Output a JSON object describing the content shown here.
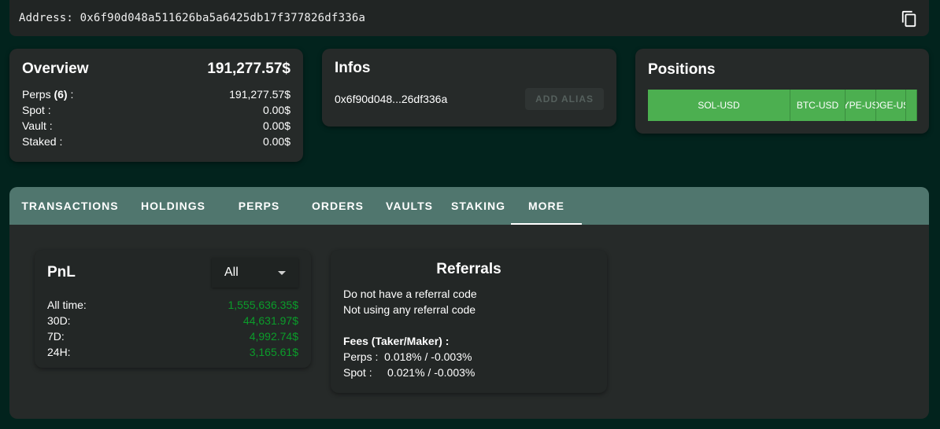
{
  "address": {
    "label": "Address:",
    "value": "0x6f90d048a511626ba5a6425db17f377826df336a",
    "copy_icon": "copy-icon"
  },
  "overview": {
    "title": "Overview",
    "total": "191,277.57$",
    "rows": [
      {
        "label": "Perps",
        "count": "(6)",
        "suffix": " :",
        "value": "191,277.57$"
      },
      {
        "label": "Spot :",
        "value": "0.00$"
      },
      {
        "label": "Vault :",
        "value": "0.00$"
      },
      {
        "label": "Staked :",
        "value": "0.00$"
      }
    ]
  },
  "infos": {
    "title": "Infos",
    "short_address": "0x6f90d048...26df336a",
    "alias_button": "ADD ALIAS"
  },
  "positions": {
    "title": "Positions",
    "segments": [
      {
        "label": "SOL-USD",
        "share": 0.53
      },
      {
        "label": "BTC-USD",
        "share": 0.205
      },
      {
        "label": "HYPE-USD",
        "share": 0.115
      },
      {
        "label": "DOGE-USD",
        "share": 0.11
      },
      {
        "label": "",
        "share": 0.04
      }
    ],
    "color": "#4caf50"
  },
  "tabs": {
    "items": [
      "TRANSACTIONS",
      "HOLDINGS",
      "PERPS",
      "ORDERS",
      "VAULTS",
      "STAKING",
      "MORE"
    ],
    "active": "MORE"
  },
  "pnl": {
    "title": "PnL",
    "filter": "All",
    "rows": [
      {
        "label": "All time:",
        "value": "1,555,636.35$"
      },
      {
        "label": "30D:",
        "value": "44,631.97$"
      },
      {
        "label": "7D:",
        "value": "4,992.74$"
      },
      {
        "label": "24H:",
        "value": "3,165.61$"
      }
    ],
    "positive_color": "#0b9c2a"
  },
  "referrals": {
    "title": "Referrals",
    "line1": "Do not have a referral code",
    "line2": "Not using any referral code",
    "fees_title": "Fees (Taker/Maker) :",
    "perps_label": "Perps :",
    "perps_value": "0.018% / -0.003%",
    "spot_label": "Spot :",
    "spot_value": "0.021% / -0.003%"
  },
  "colors": {
    "background": "#02231d",
    "card": "#262a29",
    "tab_bar": "#50766e",
    "accent_green": "#4caf50"
  }
}
